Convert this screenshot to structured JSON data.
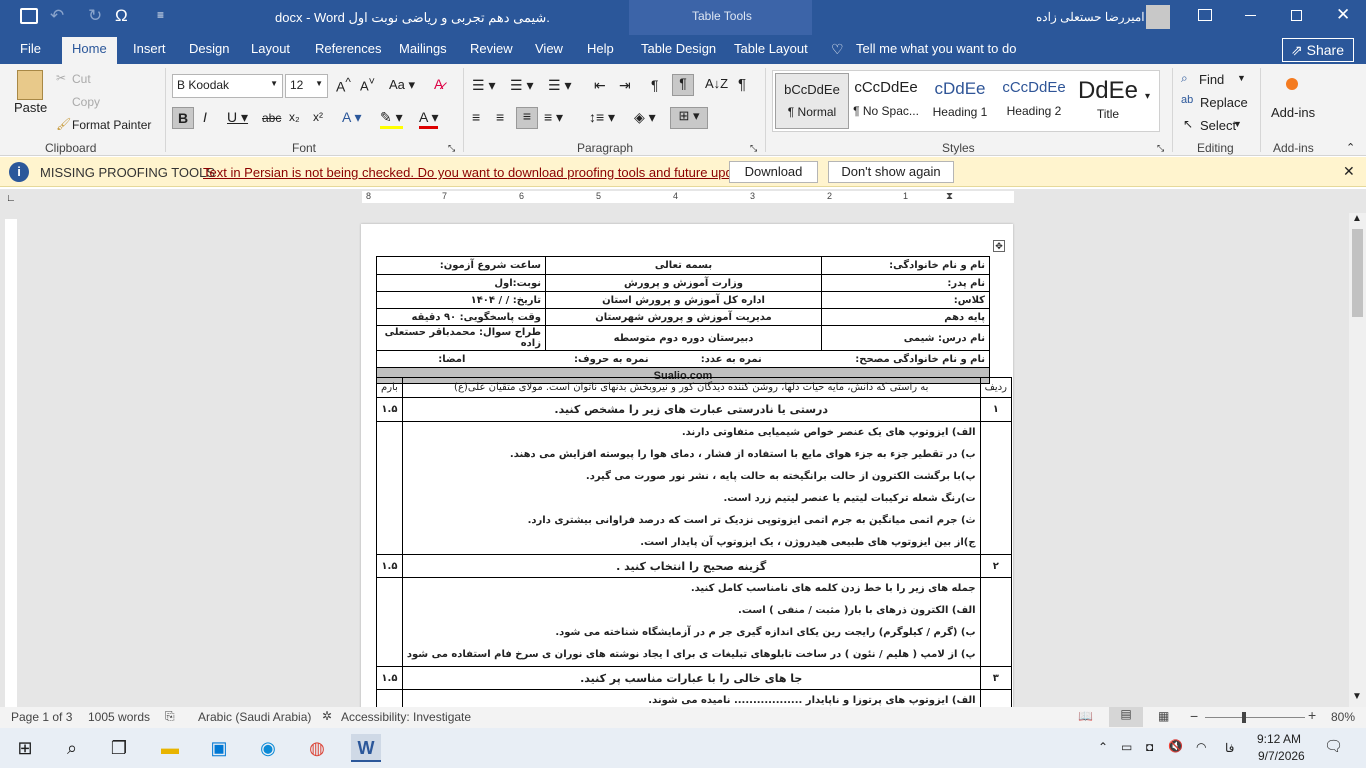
{
  "window": {
    "title": ".شیمی دهم تجربی و ریاضی نوبت اول docx - Word",
    "contextual": "Table Tools",
    "user": "امیررضا حستعلی زاده"
  },
  "tabs": [
    "File",
    "Home",
    "Insert",
    "Design",
    "Layout",
    "References",
    "Mailings",
    "Review",
    "View",
    "Help",
    "Table Design",
    "Table Layout"
  ],
  "tell_me": "Tell me what you want to do",
  "share": "Share",
  "clipboard": {
    "paste": "Paste",
    "cut": "Cut",
    "copy": "Copy",
    "format_painter": "Format Painter",
    "group": "Clipboard"
  },
  "font": {
    "name": "B Koodak",
    "size": "12",
    "group": "Font"
  },
  "paragraph": {
    "group": "Paragraph"
  },
  "styles": {
    "items": [
      {
        "sample": "bCcDdEe",
        "name": "¶ Normal"
      },
      {
        "sample": "cCcDdEe",
        "name": "¶ No Spac..."
      },
      {
        "sample": "cDdEe",
        "name": "Heading 1"
      },
      {
        "sample": "cCcDdEe",
        "name": "Heading 2"
      },
      {
        "sample": "DdEe",
        "name": "Title"
      }
    ],
    "group": "Styles"
  },
  "editing": {
    "find": "Find",
    "replace": "Replace",
    "select": "Select",
    "group": "Editing"
  },
  "addins": {
    "label": "Add-ins",
    "group": "Add-ins"
  },
  "infobar": {
    "title": "MISSING PROOFING TOOLS",
    "message": "Text in Persian is not being checked. Do you want to download proofing tools and future updates?",
    "download": "Download",
    "dont_show": "Don't show again"
  },
  "ruler_numbers": [
    "8",
    "7",
    "6",
    "5",
    "4",
    "3",
    "2",
    "1"
  ],
  "header": {
    "r1": {
      "right": "نام و نام خانوادگی:",
      "center": "بسمه تعالی",
      "left": "ساعت شروع آزمون:"
    },
    "r2": {
      "right": "نام پدر:",
      "center": "وزارت آموزش و پرورش",
      "left": "نوبت:اول"
    },
    "r3": {
      "right": "کلاس:",
      "center": "اداره کل آموزش و پرورش استان",
      "left": "تاریخ:   /   /   ۱۴۰۴"
    },
    "r4": {
      "right": "پایه دهم",
      "center": "مدیریت آموزش و پرورش شهرستان",
      "left": "وقت پاسخگویی: ۹۰ دقیقه"
    },
    "r5": {
      "right": "نام درس: شیمی",
      "center": "دبیرستان دوره دوم متوسطه",
      "left": "طراح سوال: محمدباقر حستعلی زاده"
    },
    "r6": {
      "a": "نام و نام خانوادگی مصحح:",
      "b": "نمره به عدد:",
      "c": "نمره به حروف:",
      "d": "امضا:"
    },
    "site": "Sualio.com",
    "cols": {
      "row": "ردیف",
      "quote": "به راستی که دانش، مایه حیات دلها، روشن کننده دیدگان کور و نیروبخش بدنهای ناتوان است. مولای متقیان علی(ع)",
      "score": "بارم"
    }
  },
  "questions": [
    {
      "num": "۱",
      "title": "درستی یا نادرستی عبارت های زیر را مشخص کنید.",
      "score": "۱.۵",
      "lines": [
        "الف) ایزوتوپ های یک عنصر خواص شیمیایی متفاوتی دارند.",
        "ب) در تقطیر جزء به جزء هوای مایع با استفاده از فشار ، دمای هوا را پیوسته افزایش می دهند.",
        "پ)با برگشت الکترون از حالت برانگیخته به حالت پایه ، نشر نور صورت می گیرد.",
        "ت)رنگ شعله ترکیبات لیتیم یا عنصر لیتیم زرد است.",
        "ث) جرم اتمی میانگین به جرم اتمی ایزوتوپی نزدیک تر است که درصد فراوانی بیشتری دارد.",
        "ج)از بین ایزوتوپ های طبیعی هیدروژن ، یک ایزوتوپ آن پایدار است."
      ]
    },
    {
      "num": "۲",
      "title": "گزینه صحیح را انتخاب کنید .",
      "score": "۱.۵",
      "lines": [
        "جمله های زیر را با خط زدن کلمه های نامناسب کامل کنید.",
        "الف) الکترون ذرهای با بار( مثبت / منفی ) است.",
        "ب) (گرم / کیلوگرم) رایجت رین یکای اندازه گیری جر م در آزمایشگاه شناخته می شود.",
        "پ) از لامپ ( هلیم / نئون ) در ساخت تابلوهای تبلیغات ی برای ا یجاد نوشته های نوران ی سرخ فام استفاده می شود"
      ]
    },
    {
      "num": "۳",
      "title": "جا های خالی را با عبارات مناسب پر کنید.",
      "score": "۱.۵",
      "lines": [
        "الف) ایزوتوپ های پرتوزا و ناپایدار .................. نامیده می شوند."
      ]
    }
  ],
  "status": {
    "page": "Page 1 of 3",
    "words": "1005 words",
    "language": "Arabic (Saudi Arabia)",
    "accessibility": "Accessibility: Investigate",
    "zoom": "80%"
  },
  "taskbar": {
    "time": "9:12 AM",
    "date": "9/7/2026",
    "lang": "فا"
  }
}
